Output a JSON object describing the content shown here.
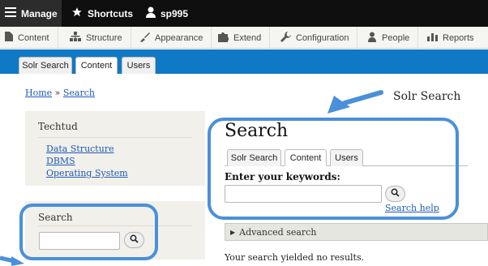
{
  "toolbar": {
    "manage": "Manage",
    "shortcuts": "Shortcuts",
    "user": "sp995"
  },
  "tray": [
    {
      "label": "Content",
      "icon": "document-icon"
    },
    {
      "label": "Structure",
      "icon": "sitemap-icon"
    },
    {
      "label": "Appearance",
      "icon": "brush-icon"
    },
    {
      "label": "Extend",
      "icon": "puzzle-icon"
    },
    {
      "label": "Configuration",
      "icon": "wrench-icon"
    },
    {
      "label": "People",
      "icon": "person-icon"
    },
    {
      "label": "Reports",
      "icon": "bar-chart-icon"
    }
  ],
  "header_tabs": [
    "Solr Search",
    "Content",
    "Users"
  ],
  "breadcrumb": {
    "home": "Home",
    "separator": "»",
    "current": "Search"
  },
  "annotation_label": "Solr Search",
  "sidebar": {
    "block_title": "Techtud",
    "links": [
      "Data Structure",
      "DBMS",
      "Operating System"
    ],
    "search_title": "Search"
  },
  "main": {
    "title": "Search",
    "tabs": [
      "Solr Search",
      "Content",
      "Users"
    ],
    "active_tab": "Content",
    "keywords_label": "Enter your keywords:",
    "search_help": "Search help",
    "advanced": "Advanced search",
    "no_results": "Your search yielded no results."
  },
  "colors": {
    "blue_header": "#0f79c5",
    "link": "#1f5bb5",
    "annotation": "#4a90d9",
    "toolbar": "#0f0f0f"
  }
}
